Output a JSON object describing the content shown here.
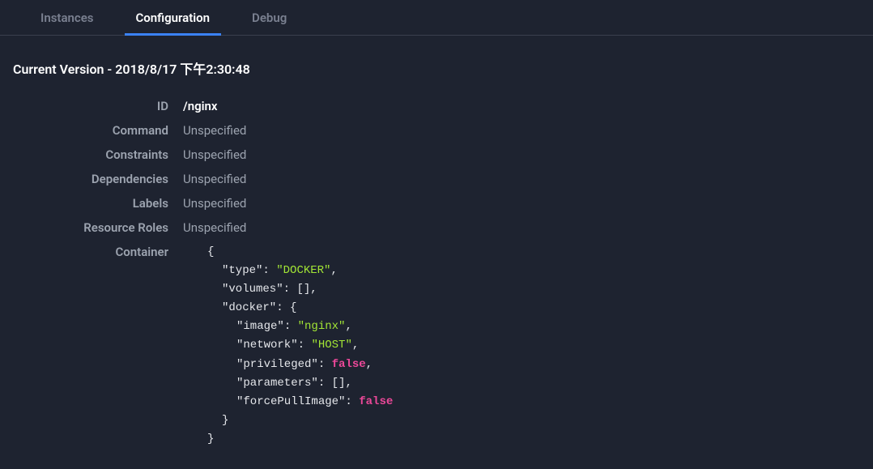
{
  "tabs": [
    {
      "label": "Instances",
      "active": false
    },
    {
      "label": "Configuration",
      "active": true
    },
    {
      "label": "Debug",
      "active": false
    }
  ],
  "versionLine": "Current Version - 2018/8/17 下午2:30:48",
  "fields": {
    "id": {
      "label": "ID",
      "value": "/nginx"
    },
    "command": {
      "label": "Command",
      "value": "Unspecified"
    },
    "constraints": {
      "label": "Constraints",
      "value": "Unspecified"
    },
    "dependencies": {
      "label": "Dependencies",
      "value": "Unspecified"
    },
    "labels": {
      "label": "Labels",
      "value": "Unspecified"
    },
    "resourceRoles": {
      "label": "Resource Roles",
      "value": "Unspecified"
    },
    "container": {
      "label": "Container"
    }
  },
  "containerJson": {
    "keys": {
      "type": "\"type\"",
      "volumes": "\"volumes\"",
      "docker": "\"docker\"",
      "image": "\"image\"",
      "network": "\"network\"",
      "privileged": "\"privileged\"",
      "parameters": "\"parameters\"",
      "forcePullImage": "\"forcePullImage\""
    },
    "values": {
      "type": "\"DOCKER\"",
      "volumes": "[]",
      "image": "\"nginx\"",
      "network": "\"HOST\"",
      "privileged": "false",
      "parameters": "[]",
      "forcePullImage": "false"
    },
    "tokens": {
      "openBrace": "{",
      "closeBrace": "}",
      "colon": ": ",
      "comma": ","
    }
  }
}
